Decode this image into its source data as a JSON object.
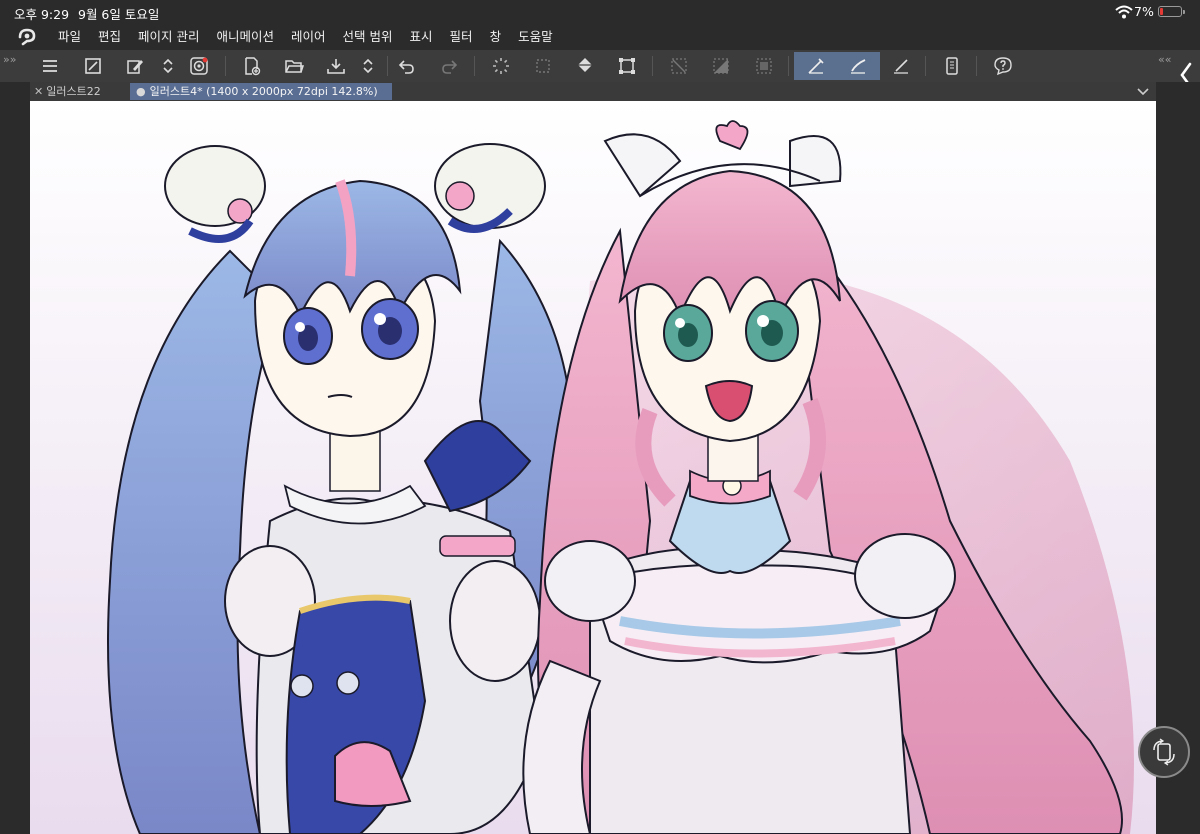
{
  "status": {
    "time": "오후 9:29",
    "date": "9월 6일 토요일",
    "battery": "7%"
  },
  "menu": [
    "파일",
    "편집",
    "페이지 관리",
    "애니메이션",
    "레이어",
    "선택 범위",
    "표시",
    "필터",
    "창",
    "도움말"
  ],
  "tabs": {
    "inactive": "일러스트22",
    "active": "일러스트4* (1400 x 2000px 72dpi 142.8%)"
  },
  "toolbar_icons": [
    "menu-icon",
    "fit-to-screen-icon",
    "edit-pen-icon",
    "up-down-icon",
    "spiral-icon",
    "new-page-icon",
    "open-folder-icon",
    "save-icon",
    "up-down-icon",
    "undo-icon",
    "redo-icon",
    "loading-spinner-icon",
    "selection-dots-icon",
    "fill-bucket-icon",
    "transform-icon",
    "deselect-icon",
    "invert-selection-icon",
    "select-all-icon",
    "pen-stroke-icon",
    "brush-stroke-icon",
    "line-stroke-icon",
    "device-icon",
    "help-icon"
  ],
  "colors": {
    "toolbar_bg": "#3c3c3c",
    "active_tab": "#5a6e94",
    "active_tool": "#5b6f8f",
    "battery_low": "#e53935"
  }
}
